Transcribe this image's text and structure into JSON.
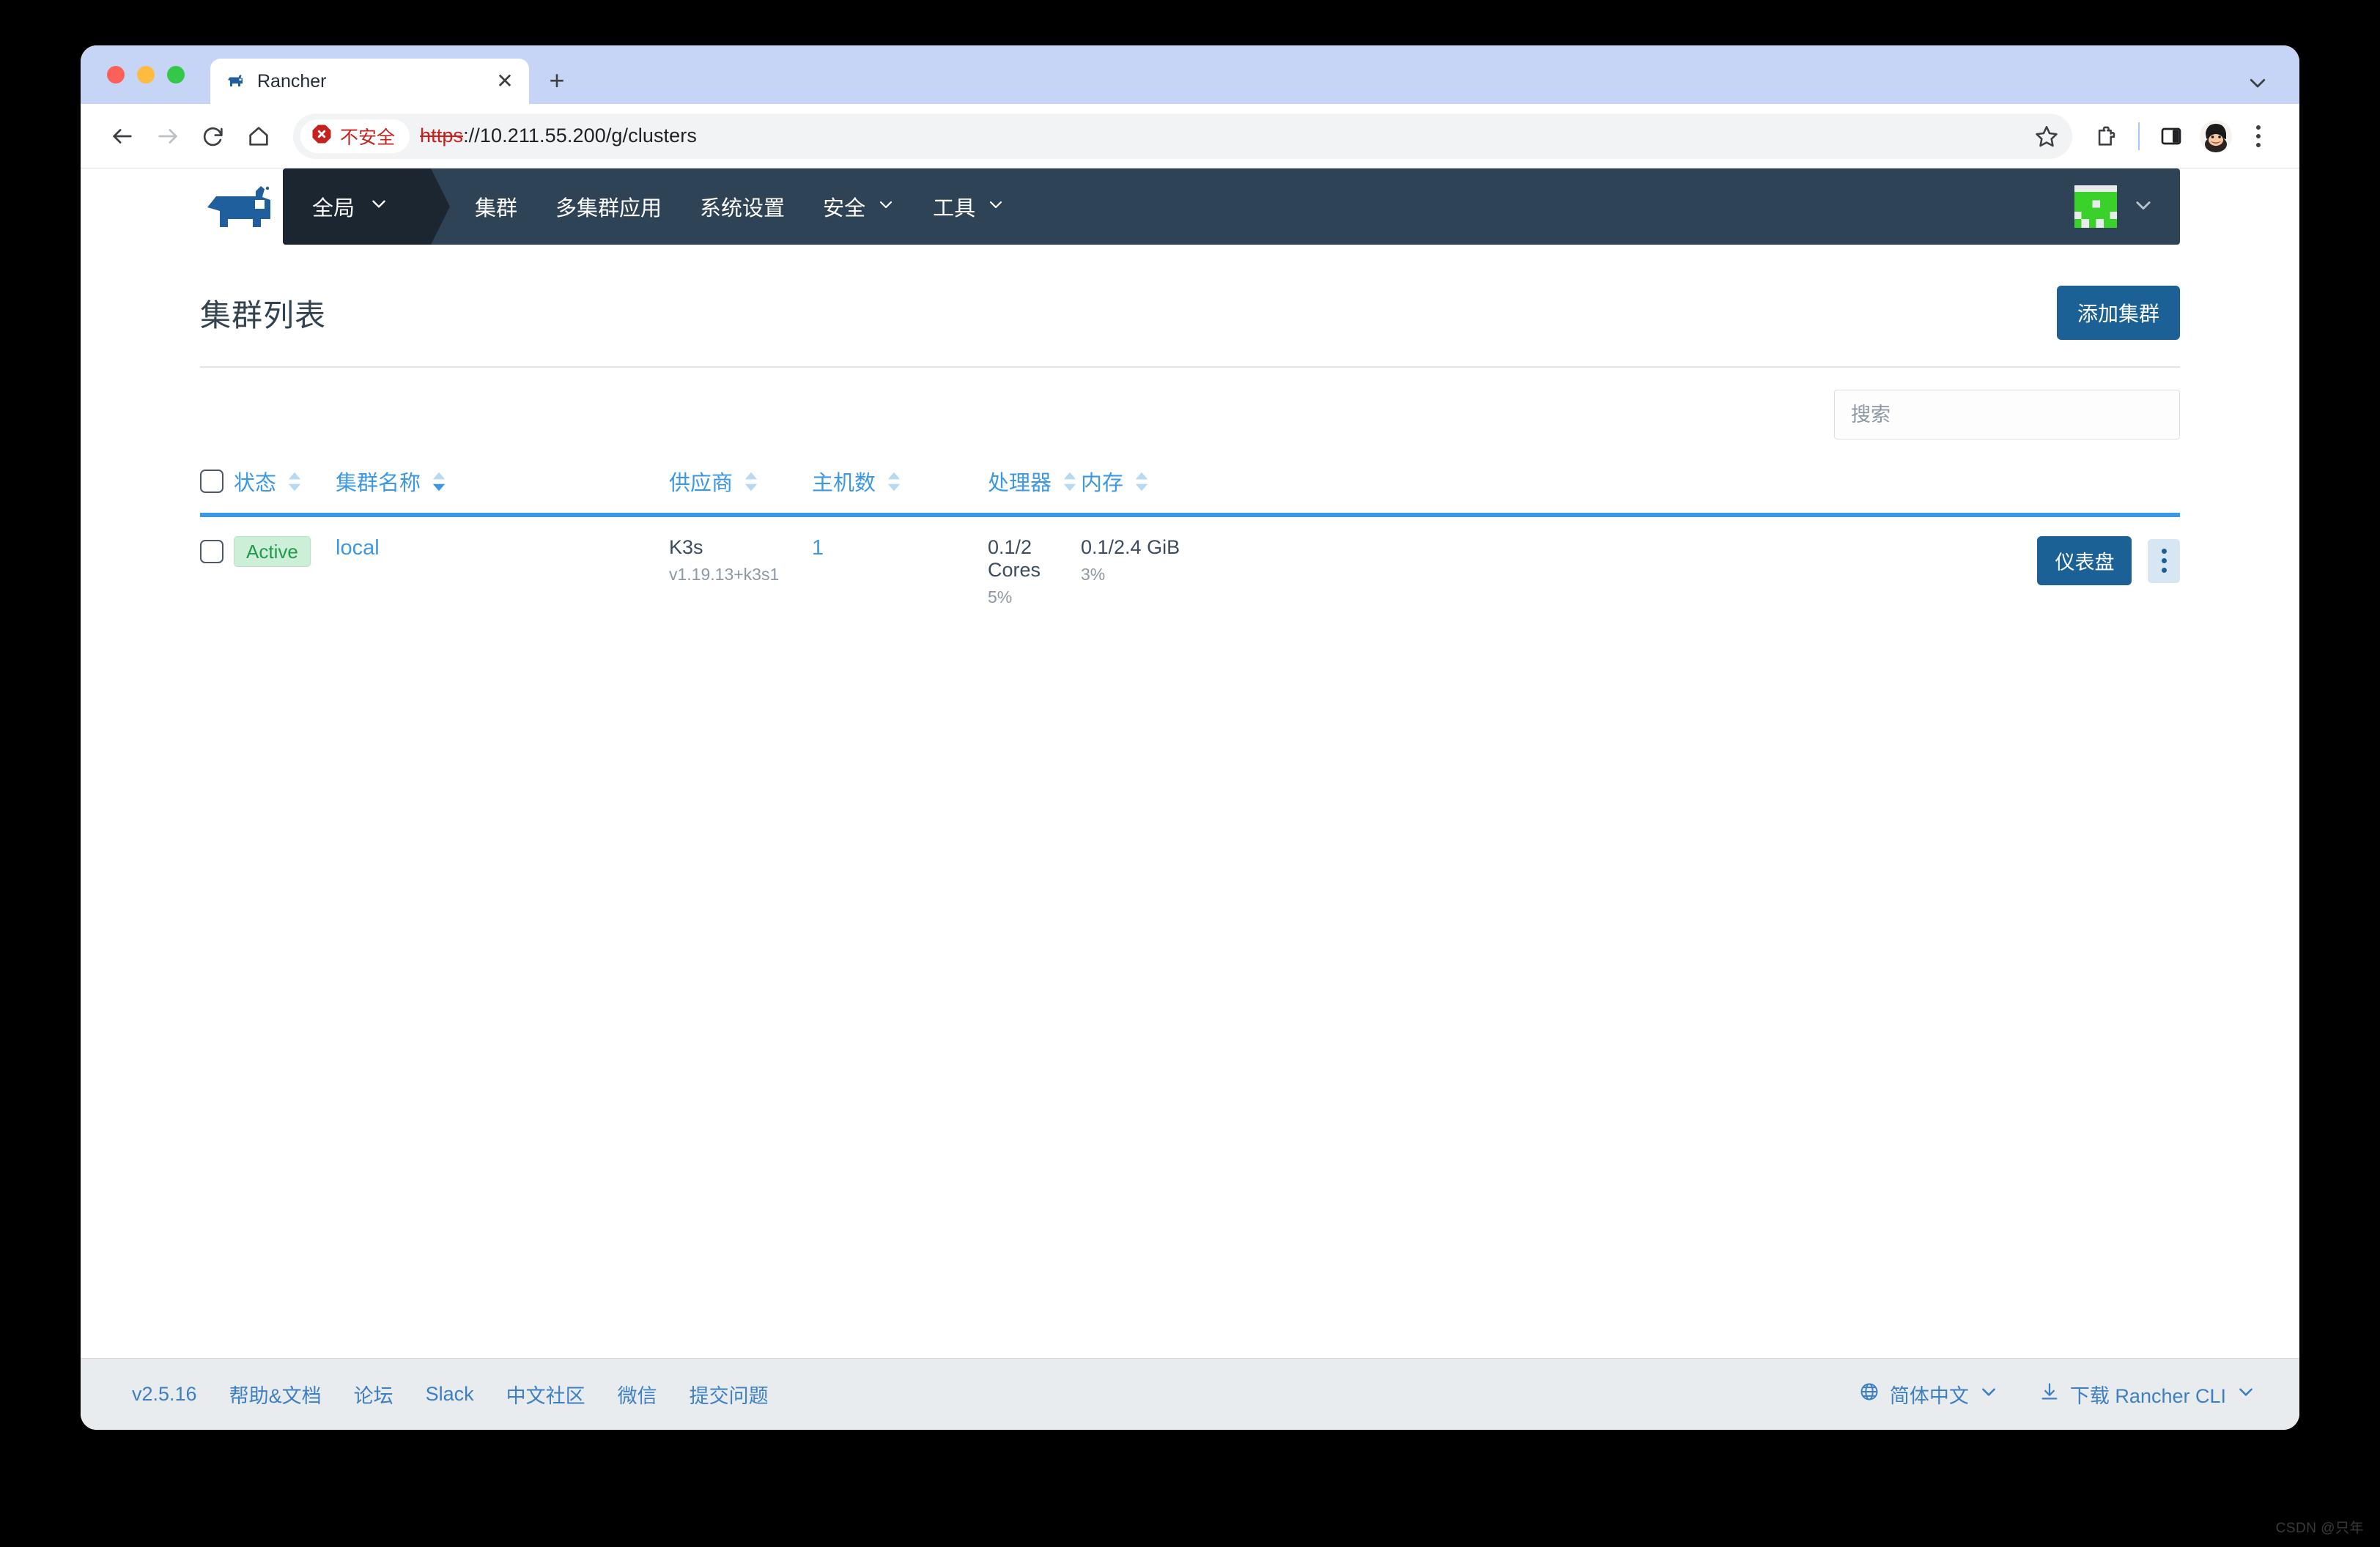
{
  "browser": {
    "tab": {
      "title": "Rancher",
      "favicon_icon": "rancher-cow-favicon",
      "close_icon": "close-icon"
    },
    "new_tab_icon": "plus-icon",
    "tab_list_icon": "chevron-down-icon",
    "nav": {
      "back_icon": "arrow-back-icon",
      "forward_icon": "arrow-forward-icon",
      "reload_icon": "reload-icon",
      "home_icon": "home-icon"
    },
    "omnibox": {
      "security_label": "不安全",
      "security_icon": "not-secure-icon",
      "url_scheme": "https",
      "url_rest": "://10.211.55.200/g/clusters",
      "bookmark_icon": "star-icon"
    },
    "toolbar": {
      "extensions_icon": "puzzle-icon",
      "side_panel_icon": "side-panel-icon",
      "profile_icon": "profile-avatar",
      "menu_icon": "kebab-menu-icon"
    }
  },
  "header": {
    "logo_icon": "rancher-cow-logo",
    "scope": {
      "label": "全局",
      "chevron_icon": "chevron-down-icon"
    },
    "nav_items": [
      {
        "label": "集群",
        "has_chevron": false
      },
      {
        "label": "多集群应用",
        "has_chevron": false
      },
      {
        "label": "系统设置",
        "has_chevron": false
      },
      {
        "label": "安全",
        "has_chevron": true
      },
      {
        "label": "工具",
        "has_chevron": true
      }
    ],
    "user_menu": {
      "avatar_icon": "user-identicon-avatar",
      "chevron_icon": "chevron-down-icon"
    }
  },
  "main": {
    "page_title": "集群列表",
    "add_cluster_label": "添加集群",
    "search": {
      "placeholder": "搜索",
      "value": ""
    },
    "table": {
      "columns": [
        {
          "key": "state",
          "label": "状态",
          "sortable": true,
          "sorted": false
        },
        {
          "key": "name",
          "label": "集群名称",
          "sortable": true,
          "sorted": true
        },
        {
          "key": "provider",
          "label": "供应商",
          "sortable": true,
          "sorted": false
        },
        {
          "key": "nodes",
          "label": "主机数",
          "sortable": true,
          "sorted": false
        },
        {
          "key": "cpu",
          "label": "处理器",
          "sortable": true,
          "sorted": false
        },
        {
          "key": "memory",
          "label": "内存",
          "sortable": true,
          "sorted": false
        },
        {
          "key": "actions",
          "label": "",
          "sortable": false,
          "sorted": false
        }
      ],
      "rows": [
        {
          "selected": false,
          "state": "Active",
          "name": "local",
          "provider": "K3s",
          "provider_version": "v1.19.13+k3s1",
          "nodes": "1",
          "cpu": "0.1/2 Cores",
          "cpu_percent": "5%",
          "memory": "0.1/2.4 GiB",
          "memory_percent": "3%",
          "dashboard_label": "仪表盘",
          "kebab_icon": "kebab-menu-icon"
        }
      ]
    }
  },
  "footer": {
    "links": [
      {
        "label": "v2.5.16"
      },
      {
        "label": "帮助&文档"
      },
      {
        "label": "论坛"
      },
      {
        "label": "Slack"
      },
      {
        "label": "中文社区"
      },
      {
        "label": "微信"
      },
      {
        "label": "提交问题"
      }
    ],
    "language": {
      "icon": "globe-icon",
      "label": "简体中文",
      "chevron_icon": "chevron-down-icon"
    },
    "cli": {
      "icon": "download-icon",
      "label": "下载 Rancher CLI",
      "chevron_icon": "chevron-down-icon"
    }
  },
  "watermark": {
    "text": "CSDN @只年"
  },
  "colors": {
    "nav_bg": "#2e4355",
    "scope_bg": "#1b2631",
    "primary_button": "#1b6196",
    "link_blue": "#3d98e3",
    "badge_bg": "#cdeed7",
    "badge_text": "#1f9c4a",
    "footer_bg": "#e8ecef",
    "title_text": "#32424f",
    "insecure_red": "#c5221f"
  }
}
